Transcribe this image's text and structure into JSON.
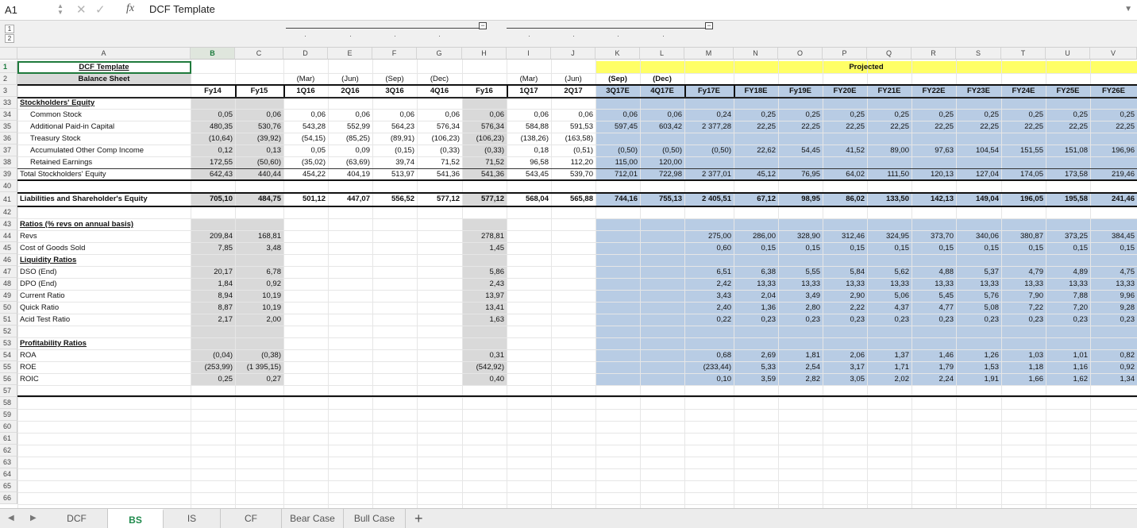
{
  "formula_bar": {
    "cell_ref": "A1",
    "fx_label": "fx",
    "formula": "DCF Template"
  },
  "outline": {
    "levels": [
      "1",
      "2"
    ],
    "collapse_symbol": "−"
  },
  "columns": [
    "A",
    "B",
    "C",
    "D",
    "E",
    "F",
    "G",
    "H",
    "I",
    "J",
    "K",
    "L",
    "M",
    "N",
    "O",
    "P",
    "Q",
    "R",
    "S",
    "T",
    "U",
    "V"
  ],
  "selected_column": "B",
  "rows_top": [
    "1",
    "2",
    "3"
  ],
  "rows_main": [
    "33",
    "34",
    "35",
    "36",
    "37",
    "38",
    "39",
    "40",
    "41",
    "42",
    "43",
    "44",
    "45",
    "46",
    "47",
    "48",
    "49",
    "50",
    "51",
    "52",
    "53",
    "54",
    "55",
    "56",
    "57",
    "58",
    "59",
    "60",
    "61",
    "62",
    "63",
    "64",
    "65",
    "66"
  ],
  "title": "DCF Template",
  "subtitle": "Balance Sheet",
  "projected_label": "Projected",
  "quarter_row": [
    "",
    "",
    "(Mar)",
    "(Jun)",
    "(Sep)",
    "(Dec)",
    "",
    "(Mar)",
    "(Jun)",
    "(Sep)",
    "(Dec)",
    "",
    "",
    "",
    "",
    "",
    "",
    "",
    "",
    "",
    ""
  ],
  "period_row": [
    "Fy14",
    "Fy15",
    "1Q16",
    "2Q16",
    "3Q16",
    "4Q16",
    "Fy16",
    "1Q17",
    "2Q17",
    "3Q17E",
    "4Q17E",
    "Fy17E",
    "FY18E",
    "Fy19E",
    "FY20E",
    "FY21E",
    "FY22E",
    "FY23E",
    "FY24E",
    "FY25E",
    "FY26E"
  ],
  "rows": [
    {
      "label": "Stockholders' Equity",
      "style": "section",
      "values": []
    },
    {
      "label": "Common Stock",
      "indent": true,
      "values": [
        "0,05",
        "0,06",
        "0,06",
        "0,06",
        "0,06",
        "0,06",
        "0,06",
        "0,06",
        "0,06",
        "0,06",
        "0,06",
        "0,24",
        "0,25",
        "0,25",
        "0,25",
        "0,25",
        "0,25",
        "0,25",
        "0,25",
        "0,25",
        "0,25"
      ]
    },
    {
      "label": "Additional Paid-in Capital",
      "indent": true,
      "values": [
        "480,35",
        "530,76",
        "543,28",
        "552,99",
        "564,23",
        "576,34",
        "576,34",
        "584,88",
        "591,53",
        "597,45",
        "603,42",
        "2 377,28",
        "22,25",
        "22,25",
        "22,25",
        "22,25",
        "22,25",
        "22,25",
        "22,25",
        "22,25",
        "22,25"
      ]
    },
    {
      "label": "Treasury Stock",
      "indent": true,
      "values": [
        "(10,64)",
        "(39,92)",
        "(54,15)",
        "(85,25)",
        "(89,91)",
        "(106,23)",
        "(106,23)",
        "(138,26)",
        "(163,58)",
        "",
        "",
        "",
        "",
        "",
        "",
        "",
        "",
        "",
        "",
        "",
        ""
      ]
    },
    {
      "label": "Accumulated Other Comp Income",
      "indent": true,
      "values": [
        "0,12",
        "0,13",
        "0,05",
        "0,09",
        "(0,15)",
        "(0,33)",
        "(0,33)",
        "0,18",
        "(0,51)",
        "(0,50)",
        "(0,50)",
        "(0,50)",
        "22,62",
        "54,45",
        "41,52",
        "89,00",
        "97,63",
        "104,54",
        "151,55",
        "151,08",
        "196,96"
      ]
    },
    {
      "label": "Retained Earnings",
      "indent": true,
      "values": [
        "172,55",
        "(50,60)",
        "(35,02)",
        "(63,69)",
        "39,74",
        "71,52",
        "71,52",
        "96,58",
        "112,20",
        "115,00",
        "120,00",
        "",
        "",
        "",
        "",
        "",
        "",
        "",
        "",
        "",
        ""
      ]
    },
    {
      "label": "Total Stockholders' Equity",
      "values": [
        "642,43",
        "440,44",
        "454,22",
        "404,19",
        "513,97",
        "541,36",
        "541,36",
        "543,45",
        "539,70",
        "712,01",
        "722,98",
        "2 377,01",
        "45,12",
        "76,95",
        "64,02",
        "111,50",
        "120,13",
        "127,04",
        "174,05",
        "173,58",
        "219,46"
      ]
    },
    {
      "label": "",
      "values": []
    },
    {
      "label": "Liabilities and Shareholder's Equity",
      "values": [
        "705,10",
        "484,75",
        "501,12",
        "447,07",
        "556,52",
        "577,12",
        "577,12",
        "568,04",
        "565,88",
        "744,16",
        "755,13",
        "2 405,51",
        "67,12",
        "98,95",
        "86,02",
        "133,50",
        "142,13",
        "149,04",
        "196,05",
        "195,58",
        "241,46"
      ]
    },
    {
      "label": "",
      "values": []
    },
    {
      "label": "Ratios (% revs on annual basis)",
      "style": "section",
      "values": []
    },
    {
      "label": "Revs",
      "values": [
        "209,84",
        "168,81",
        "",
        "",
        "",
        "",
        "278,81",
        "",
        "",
        "",
        "",
        "275,00",
        "286,00",
        "328,90",
        "312,46",
        "324,95",
        "373,70",
        "340,06",
        "380,87",
        "373,25",
        "384,45"
      ]
    },
    {
      "label": "Cost of Goods Sold",
      "values": [
        "7,85",
        "3,48",
        "",
        "",
        "",
        "",
        "1,45",
        "",
        "",
        "",
        "",
        "0,60",
        "0,15",
        "0,15",
        "0,15",
        "0,15",
        "0,15",
        "0,15",
        "0,15",
        "0,15",
        "0,15"
      ]
    },
    {
      "label": "Liquidity Ratios",
      "style": "section",
      "values": []
    },
    {
      "label": "DSO (End)",
      "values": [
        "20,17",
        "6,78",
        "",
        "",
        "",
        "",
        "5,86",
        "",
        "",
        "",
        "",
        "6,51",
        "6,38",
        "5,55",
        "5,84",
        "5,62",
        "4,88",
        "5,37",
        "4,79",
        "4,89",
        "4,75"
      ]
    },
    {
      "label": "DPO (End)",
      "values": [
        "1,84",
        "0,92",
        "",
        "",
        "",
        "",
        "2,43",
        "",
        "",
        "",
        "",
        "2,42",
        "13,33",
        "13,33",
        "13,33",
        "13,33",
        "13,33",
        "13,33",
        "13,33",
        "13,33",
        "13,33"
      ]
    },
    {
      "label": "Current Ratio",
      "values": [
        "8,94",
        "10,19",
        "",
        "",
        "",
        "",
        "13,97",
        "",
        "",
        "",
        "",
        "3,43",
        "2,04",
        "3,49",
        "2,90",
        "5,06",
        "5,45",
        "5,76",
        "7,90",
        "7,88",
        "9,96"
      ]
    },
    {
      "label": "Quick Ratio",
      "values": [
        "8,87",
        "10,19",
        "",
        "",
        "",
        "",
        "13,41",
        "",
        "",
        "",
        "",
        "2,40",
        "1,36",
        "2,80",
        "2,22",
        "4,37",
        "4,77",
        "5,08",
        "7,22",
        "7,20",
        "9,28"
      ]
    },
    {
      "label": "Acid Test Ratio",
      "values": [
        "2,17",
        "2,00",
        "",
        "",
        "",
        "",
        "1,63",
        "",
        "",
        "",
        "",
        "0,22",
        "0,23",
        "0,23",
        "0,23",
        "0,23",
        "0,23",
        "0,23",
        "0,23",
        "0,23",
        "0,23"
      ]
    },
    {
      "label": "",
      "values": []
    },
    {
      "label": "Profitability Ratios",
      "style": "section",
      "values": []
    },
    {
      "label": "ROA",
      "values": [
        "(0,04)",
        "(0,38)",
        "",
        "",
        "",
        "",
        "0,31",
        "",
        "",
        "",
        "",
        "0,68",
        "2,69",
        "1,81",
        "2,06",
        "1,37",
        "1,46",
        "1,26",
        "1,03",
        "1,01",
        "0,82"
      ]
    },
    {
      "label": "ROE",
      "values": [
        "(253,99)",
        "(1 395,15)",
        "",
        "",
        "",
        "",
        "(542,92)",
        "",
        "",
        "",
        "",
        "(233,44)",
        "5,33",
        "2,54",
        "3,17",
        "1,71",
        "1,79",
        "1,53",
        "1,18",
        "1,16",
        "0,92"
      ]
    },
    {
      "label": "ROIC",
      "values": [
        "0,25",
        "0,27",
        "",
        "",
        "",
        "",
        "0,40",
        "",
        "",
        "",
        "",
        "0,10",
        "3,59",
        "2,82",
        "3,05",
        "2,02",
        "2,24",
        "1,91",
        "1,66",
        "1,62",
        "1,34"
      ]
    }
  ],
  "sheet_tabs": [
    {
      "name": "DCF",
      "active": false
    },
    {
      "name": "BS",
      "active": true
    },
    {
      "name": "IS",
      "active": false
    },
    {
      "name": "CF",
      "active": false
    },
    {
      "name": "Bear Case",
      "active": false
    },
    {
      "name": "Bull Case",
      "active": false
    }
  ],
  "add_tab_label": "+",
  "colors": {
    "projected_yellow": "#ffff66",
    "projected_blue": "#b8cce4",
    "history_gray": "#d9d9d9",
    "selection": "#1f7a3c"
  }
}
